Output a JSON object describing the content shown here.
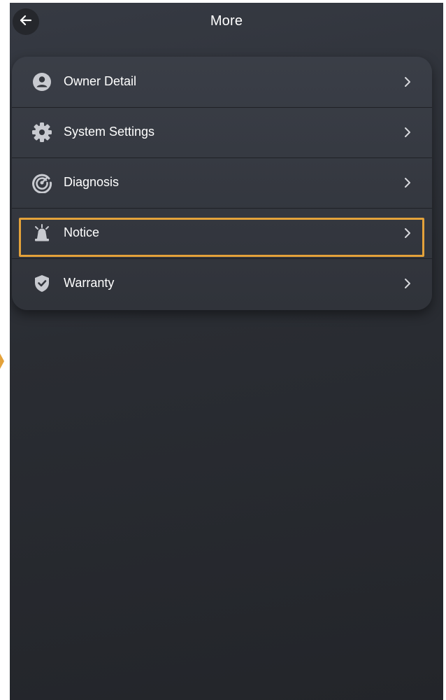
{
  "header": {
    "title": "More",
    "back_icon": "arrow-left-icon"
  },
  "menu": {
    "items": [
      {
        "label": "Owner Detail",
        "icon": "user-circle-icon"
      },
      {
        "label": "System Settings",
        "icon": "gear-icon"
      },
      {
        "label": "Diagnosis",
        "icon": "gauge-icon"
      },
      {
        "label": "Notice",
        "icon": "alarm-light-icon",
        "highlighted": true
      },
      {
        "label": "Warranty",
        "icon": "shield-check-icon"
      }
    ]
  },
  "colors": {
    "background_top": "#363a43",
    "background_bottom": "#23252a",
    "card": "#363a42",
    "icon": "#c8cad0",
    "highlight": "#e4a23a",
    "text": "#ffffff"
  }
}
